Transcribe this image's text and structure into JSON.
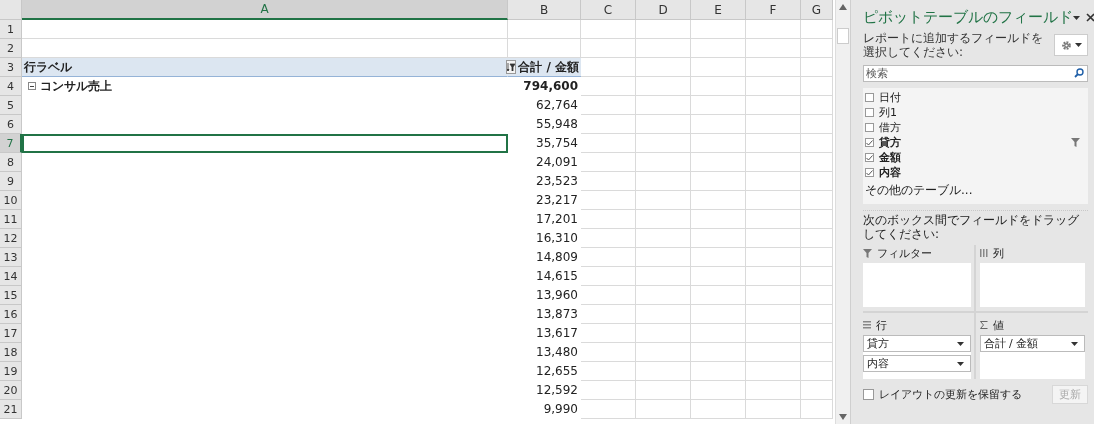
{
  "sheet": {
    "columns": [
      {
        "label": "A",
        "selected": true
      },
      {
        "label": "B",
        "selected": false
      },
      {
        "label": "C",
        "selected": false
      },
      {
        "label": "D",
        "selected": false
      },
      {
        "label": "E",
        "selected": false
      },
      {
        "label": "F",
        "selected": false
      },
      {
        "label": "G",
        "selected": false
      }
    ],
    "rows": [
      {
        "number": "1",
        "kind": "blank",
        "selected": false
      },
      {
        "number": "2",
        "kind": "blank",
        "selected": false
      },
      {
        "number": "3",
        "kind": "header",
        "label": "行ラベル",
        "value": "合計 / 金額",
        "selected": false
      },
      {
        "number": "4",
        "kind": "group",
        "label": "コンサル売上",
        "value": "794,600",
        "expanded": true,
        "selected": false
      },
      {
        "number": "5",
        "kind": "value",
        "value": "62,764",
        "selected": false
      },
      {
        "number": "6",
        "kind": "value",
        "value": "55,948",
        "selected": false
      },
      {
        "number": "7",
        "kind": "value",
        "value": "35,754",
        "selected": true
      },
      {
        "number": "8",
        "kind": "value",
        "value": "24,091",
        "selected": false
      },
      {
        "number": "9",
        "kind": "value",
        "value": "23,523",
        "selected": false
      },
      {
        "number": "10",
        "kind": "value",
        "value": "23,217",
        "selected": false
      },
      {
        "number": "11",
        "kind": "value",
        "value": "17,201",
        "selected": false
      },
      {
        "number": "12",
        "kind": "value",
        "value": "16,310",
        "selected": false
      },
      {
        "number": "13",
        "kind": "value",
        "value": "14,809",
        "selected": false
      },
      {
        "number": "14",
        "kind": "value",
        "value": "14,615",
        "selected": false
      },
      {
        "number": "15",
        "kind": "value",
        "value": "13,960",
        "selected": false
      },
      {
        "number": "16",
        "kind": "value",
        "value": "13,873",
        "selected": false
      },
      {
        "number": "17",
        "kind": "value",
        "value": "13,617",
        "selected": false
      },
      {
        "number": "18",
        "kind": "value",
        "value": "13,480",
        "selected": false
      },
      {
        "number": "19",
        "kind": "value",
        "value": "12,655",
        "selected": false
      },
      {
        "number": "20",
        "kind": "value",
        "value": "12,592",
        "selected": false
      },
      {
        "number": "21",
        "kind": "value",
        "value": "9,990",
        "selected": false
      }
    ]
  },
  "pivot_panel": {
    "title": "ピボットテーブルのフィールド",
    "prompt": "レポートに追加するフィールドを選択してください:",
    "search": {
      "placeholder": "検索"
    },
    "fields": [
      {
        "label": "日付",
        "checked": false,
        "filtered": false
      },
      {
        "label": "列1",
        "checked": false,
        "filtered": false
      },
      {
        "label": "借方",
        "checked": false,
        "filtered": false
      },
      {
        "label": "貸方",
        "checked": true,
        "filtered": true
      },
      {
        "label": "金額",
        "checked": true,
        "filtered": false
      },
      {
        "label": "内容",
        "checked": true,
        "filtered": false
      }
    ],
    "more_tables": "その他のテーブル...",
    "drag_hint": "次のボックス間でフィールドをドラッグしてください:",
    "areas": [
      {
        "kind": "filter",
        "label": "フィルター"
      },
      {
        "kind": "columns",
        "label": "列"
      },
      {
        "kind": "rows",
        "label": "行",
        "items": [
          "貸方",
          "内容"
        ]
      },
      {
        "kind": "values",
        "label": "値",
        "items": [
          "合計 / 金額"
        ]
      }
    ],
    "defer": {
      "label": "レイアウトの更新を保留する",
      "checked": false
    },
    "update_button": {
      "label": "更新",
      "disabled": true
    }
  }
}
